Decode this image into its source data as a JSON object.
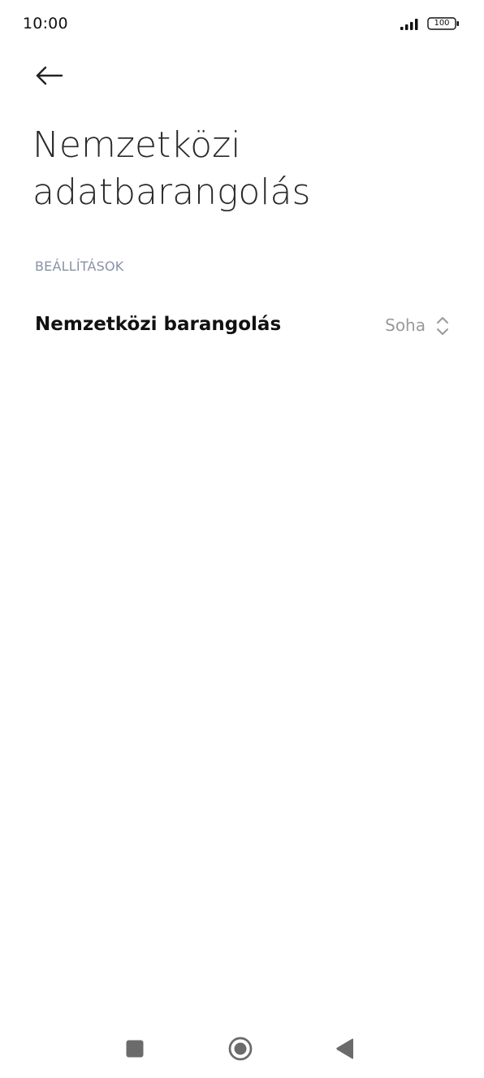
{
  "status_bar": {
    "time": "10:00",
    "battery_level": "100",
    "signal_icon": "signal-bars-icon",
    "battery_icon": "battery-icon"
  },
  "header": {
    "back_icon": "arrow-left-icon",
    "title_line1": "Nemzetközi",
    "title_line2": "adatbarangolás"
  },
  "settings": {
    "section_label": "BEÁLLÍTÁSOK",
    "items": [
      {
        "label": "Nemzetközi barangolás",
        "value": "Soha",
        "icon": "chevron-up-down-icon"
      }
    ]
  },
  "nav_bar": {
    "recents_icon": "square-icon",
    "home_icon": "circle-icon",
    "back_icon": "triangle-left-icon"
  },
  "colors": {
    "background": "#ffffff",
    "title": "#2a2a2a",
    "section_label": "#8a92a8",
    "value_text": "#9a9a9a",
    "nav_icons": "#6b6b6b"
  }
}
